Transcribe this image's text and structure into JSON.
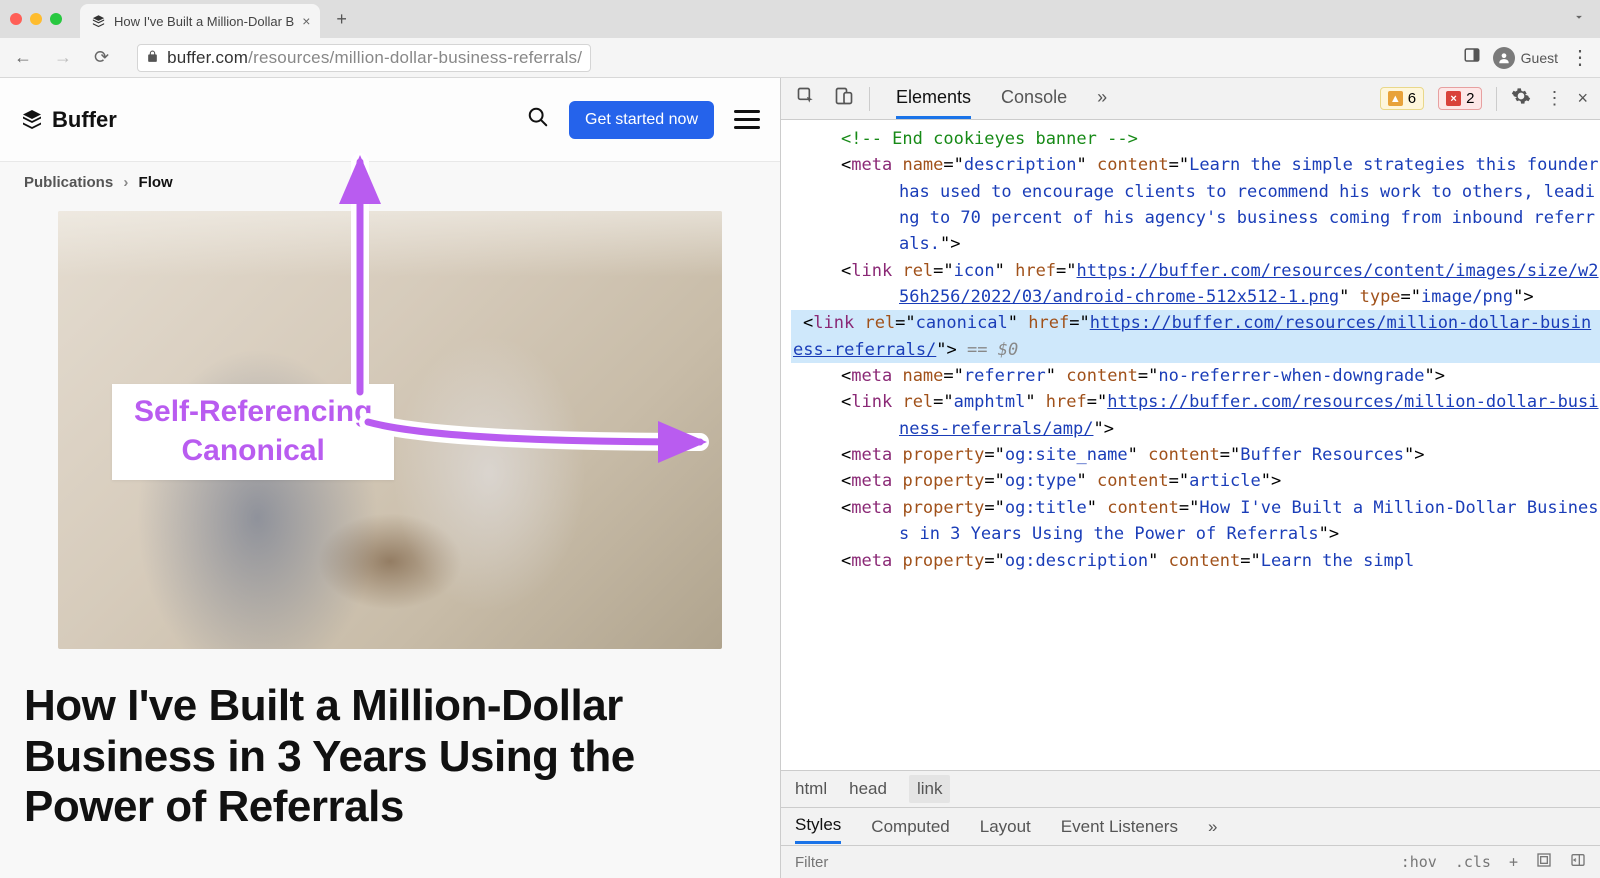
{
  "browser": {
    "tab_title": "How I've Built a Million-Dollar B",
    "url_domain": "buffer.com",
    "url_path": "/resources/million-dollar-business-referrals/",
    "guest_label": "Guest"
  },
  "page": {
    "logo_text": "Buffer",
    "cta_label": "Get started now",
    "breadcrumb_root": "Publications",
    "breadcrumb_current": "Flow",
    "article_title": "How I've Built a Million-Dollar Business in 3 Years Using the Power of Referrals"
  },
  "annotation": {
    "line1": "Self-Referencing",
    "line2": "Canonical"
  },
  "devtools": {
    "tab_elements": "Elements",
    "tab_console": "Console",
    "warn_count": "6",
    "err_count": "2",
    "crumb_html": "html",
    "crumb_head": "head",
    "crumb_link": "link",
    "stab_styles": "Styles",
    "stab_computed": "Computed",
    "stab_layout": "Layout",
    "stab_events": "Event Listeners",
    "filter_placeholder": "Filter",
    "tool_hov": ":hov",
    "tool_cls": ".cls",
    "code": {
      "comment": "<!-- End cookieyes banner -->",
      "meta_desc_open": "meta",
      "meta_desc_name": "description",
      "meta_desc_content": "Learn the simple strategies this founder has used to encourage clients to recommend his work to others, leading to 70 percent of his agency's business coming from inbound referrals.",
      "icon_rel": "icon",
      "icon_href": "https://buffer.com/resources/content/images/size/w256h256/2022/03/android-chrome-512x512-1.png",
      "icon_type": "image/png",
      "canonical_rel": "canonical",
      "canonical_href": "https://buffer.com/resources/million-dollar-business-referrals/",
      "selection_suffix": " == $0",
      "referrer_name": "referrer",
      "referrer_content": "no-referrer-when-downgrade",
      "amphtml_rel": "amphtml",
      "amphtml_href": "https://buffer.com/resources/million-dollar-business-referrals/amp/",
      "og_sitename_prop": "og:site_name",
      "og_sitename_content": "Buffer Resources",
      "og_type_prop": "og:type",
      "og_type_content": "article",
      "og_title_prop": "og:title",
      "og_title_content": "How I've Built a Million-Dollar Business in 3 Years Using the Power of Referrals",
      "og_desc_prop": "og:description",
      "og_desc_prefix": "Learn the simpl"
    }
  }
}
